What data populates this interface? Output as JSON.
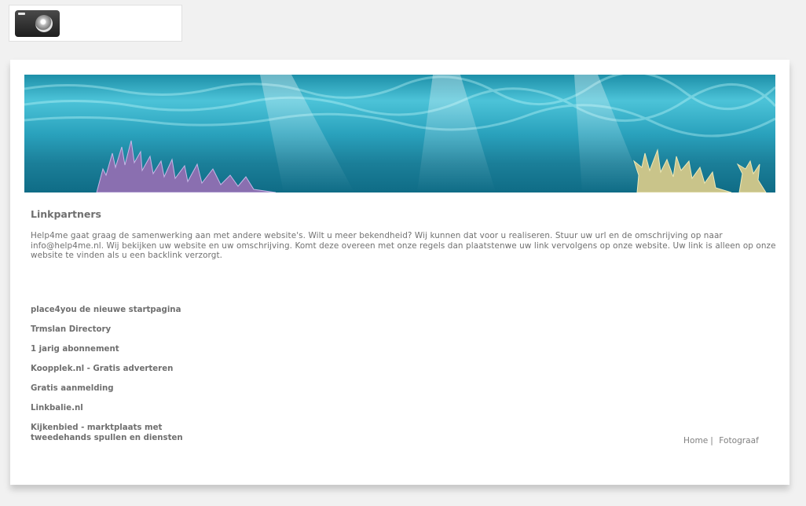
{
  "header": {
    "logo_icon": "camera-icon"
  },
  "banner": {
    "image": "underwater-coral-banner",
    "colors": {
      "water": "#2aa2bd",
      "coral_left": "#8a6fb0",
      "coral_right": "#c9c48a"
    }
  },
  "main": {
    "heading": "Linkpartners",
    "intro": "Help4me gaat graag de samenwerking aan met andere website's. Wilt u meer bekendheid? Wij kunnen dat voor u realiseren. Stuur uw url en de omschrijving op naar info@help4me.nl. Wij bekijken uw website en uw omschrijving. Komt deze overeen met onze regels dan plaatstenwe uw  link vervolgens op onze website. Uw link is alleen op onze website te vinden als u een backlink verzorgt.",
    "links": [
      {
        "label": "place4you de nieuwe startpagina"
      },
      {
        "label": "Trmslan Directory"
      },
      {
        "label": "1 jarig abonnement"
      },
      {
        "label": "Koopplek.nl - Gratis adverteren"
      },
      {
        "label": "Gratis aanmelding"
      },
      {
        "label": "Linkbalie.nl"
      },
      {
        "label": "Kijkenbied - marktplaats met tweedehands spullen en diensten"
      }
    ]
  },
  "footer": {
    "home_label": "Home",
    "separator": "|",
    "fotograaf_label": "Fotograaf"
  }
}
